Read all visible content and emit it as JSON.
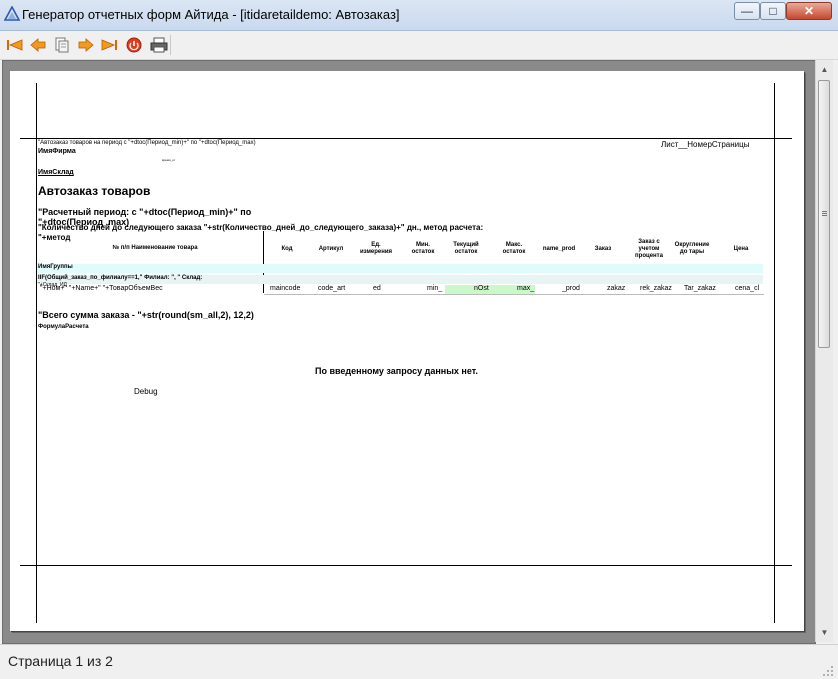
{
  "window": {
    "title": "Генератор отчетных форм Айтида - [itidaretaildemo: Автозаказ]",
    "minimize": "—",
    "maximize": "□",
    "close": "✕"
  },
  "toolbar": {
    "first": "first-page",
    "prev": "previous-page",
    "fit": "page-fit",
    "next": "next-page",
    "last": "last-page",
    "stop": "stop",
    "print": "print"
  },
  "report": {
    "header_period": "\"Автозаказ товаров на период с \"+dtoc(Период_min)+\" по \"+dtoc(Период_max)",
    "firm": "ИмяФирма",
    "tiny_mark": "время_от",
    "sheet": "Лист__НомерСтраницы",
    "warehouse": "ИмяСклад",
    "title": "Автозаказ товаров",
    "period_line1": "\"Расчетный период: с \"+dtoc(Период_min)+\" по",
    "period_line2": "\"+dtoc(Период_max)",
    "days_line": "\"Количество дней до следующего заказа \"+str(Количество_дней_до_следующего_заказа)+\" дн., метод расчета:",
    "method": "\"+метод",
    "columns": {
      "num_name": "№ п/п  Наименование товара",
      "code": "Код",
      "article": "Артикул",
      "unit": "Ед. измерения",
      "min": "Мин. остаток",
      "current": "Текущий остаток",
      "max": "Макс. остаток",
      "name_prod": "name_prod",
      "order": "Заказ",
      "order_pct": "Заказ с учетом процента",
      "round": "Округление до тары",
      "price": "Цена"
    },
    "group": "ИмяГруппы",
    "iif_line": "IIF(Общий_заказ_по_филиалу==1,\" Филиал: \", \" Склад:",
    "iif_under": "\"+Склад_ИД",
    "row": {
      "name": "\"+Ном+\" \"+Name+\" \"+ТоварОбъемВес",
      "code": "maincode",
      "article": "code_art",
      "unit": "ed",
      "min": "min_",
      "current": "nOst",
      "max": "max_",
      "name_prod": "_prod",
      "order": "zakaz",
      "order_pct": "rek_zakaz",
      "round": "Tar_zakaz",
      "price": "cena_cl"
    },
    "total": "\"Всего сумма заказа  -  \"+str(round(sm_all,2), 12,2)",
    "formula": "ФормулаРасчета",
    "no_data": "По введенному запросу данных нет.",
    "debug": "Debug"
  },
  "colors": {
    "group_band": "#e0fbfb",
    "iif_band": "#e8f4f4",
    "highlight_green": "#ccf7c8"
  },
  "status": {
    "page_info": "Страница 1 из 2"
  }
}
